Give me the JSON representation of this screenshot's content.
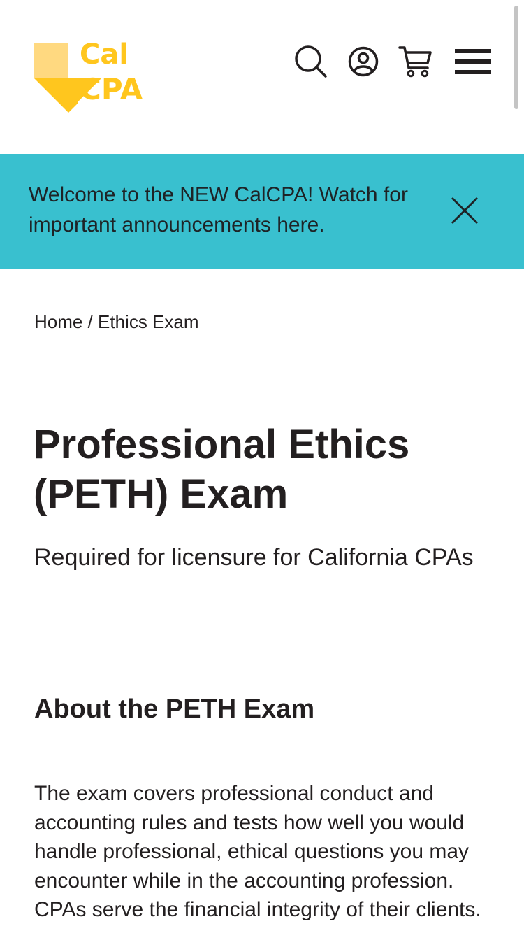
{
  "header": {
    "logo": {
      "line1": "Cal",
      "line2": "CPA"
    },
    "icons": {
      "search": "search-icon",
      "account": "user-circle-icon",
      "cart": "shopping-cart-icon",
      "menu": "hamburger-menu-icon"
    }
  },
  "banner": {
    "text": "Welcome to the NEW CalCPA! Watch for important announcements here.",
    "close_icon": "close-icon",
    "background_color": "#39c0cf"
  },
  "breadcrumb": {
    "home": "Home",
    "separator": " / ",
    "current": "Ethics Exam"
  },
  "main": {
    "title": "Professional Ethics (PETH) Exam",
    "subtitle": "Required for licensure for California CPAs",
    "section_heading": "About the PETH Exam",
    "body": "The exam covers professional conduct and accounting rules and tests how well you would handle professional, ethical questions you may encounter while in the accounting profession. CPAs serve the financial integrity of their clients."
  },
  "colors": {
    "brand_yellow": "#ffc61e",
    "brand_yellow_light": "#ffd980",
    "text": "#231f20"
  }
}
